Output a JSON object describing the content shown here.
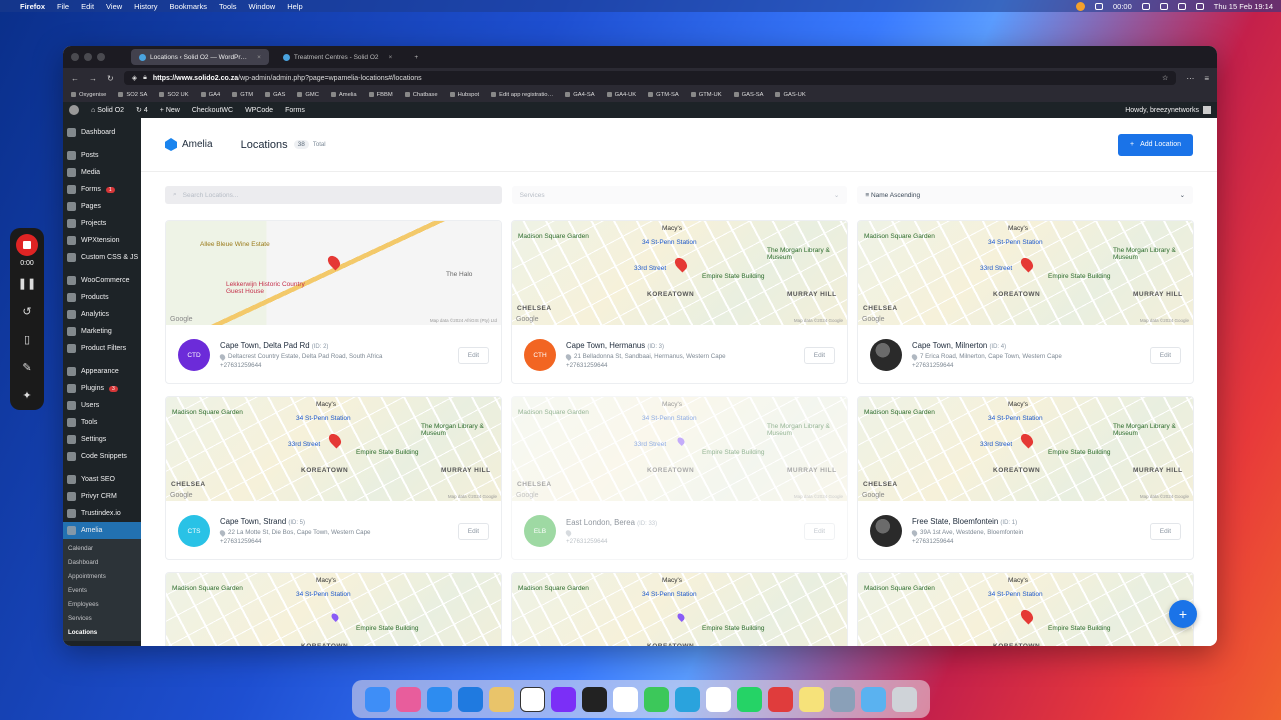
{
  "menubar": {
    "apple": "",
    "items": [
      "Firefox",
      "File",
      "Edit",
      "View",
      "History",
      "Bookmarks",
      "Tools",
      "Window",
      "Help"
    ],
    "clock": "00:00",
    "datetime": "Thu 15 Feb  19:14"
  },
  "recorder": {
    "time": "0:00"
  },
  "browser": {
    "tabs": [
      {
        "label": "Locations ‹ Solid O2 — WordPr…"
      },
      {
        "label": "Treatment Centres - Solid O2"
      }
    ],
    "url_host": "https://www.solido2.co.za",
    "url_path": "/wp-admin/admin.php?page=wpamelia-locations#/locations",
    "bookmarks": [
      "Oxygenise",
      "SO2 SA",
      "SO2 UK",
      "GA4",
      "GTM",
      "GAS",
      "GMC",
      "Amelia",
      "FBBM",
      "Chatbase",
      "Hubspot",
      "Edit app registratio…",
      "GA4-SA",
      "GA4-UK",
      "GTM-SA",
      "GTM-UK",
      "GAS-SA",
      "GAS-UK"
    ]
  },
  "adminbar": {
    "site": "Solid O2",
    "updates": "4",
    "new": "New",
    "checkout": "CheckoutWC",
    "wpcode": "WPCode",
    "forms": "Forms",
    "howdy": "Howdy, breezynetworks"
  },
  "sidebar": {
    "items": [
      {
        "label": "Dashboard"
      },
      {
        "label": "Posts"
      },
      {
        "label": "Media"
      },
      {
        "label": "Forms",
        "badge": "1"
      },
      {
        "label": "Pages"
      },
      {
        "label": "Projects"
      },
      {
        "label": "WPXtension"
      },
      {
        "label": "Custom CSS & JS"
      },
      {
        "label": "WooCommerce"
      },
      {
        "label": "Products"
      },
      {
        "label": "Analytics"
      },
      {
        "label": "Marketing"
      },
      {
        "label": "Product Filters"
      },
      {
        "label": "Appearance"
      },
      {
        "label": "Plugins",
        "badge": "3"
      },
      {
        "label": "Users"
      },
      {
        "label": "Tools"
      },
      {
        "label": "Settings"
      },
      {
        "label": "Code Snippets"
      },
      {
        "label": "Yoast SEO"
      },
      {
        "label": "Privyr CRM"
      },
      {
        "label": "Trustindex.io"
      },
      {
        "label": "Amelia"
      }
    ],
    "sub": [
      "Calendar",
      "Dashboard",
      "Appointments",
      "Events",
      "Employees",
      "Services",
      "Locations"
    ]
  },
  "amelia": {
    "brand": "Amelia",
    "title": "Locations",
    "count": "38",
    "total_label": "Total",
    "add_label": "Add Location",
    "search_placeholder": "Search Locations...",
    "services_placeholder": "Services",
    "sort_label": "Name Ascending",
    "edit_label": "Edit"
  },
  "locations": [
    {
      "initials": "CTD",
      "color": "#6c2bd9",
      "name": "Cape Town, Delta Pad Rd",
      "id": "(ID: 2)",
      "address": "Deltacrest Country Estate, Delta Pad Road, South Africa",
      "phone": "+27631259644",
      "map": "cape"
    },
    {
      "initials": "CTH",
      "color": "#f26522",
      "name": "Cape Town, Hermanus",
      "id": "(ID: 3)",
      "address": "21 Belladonna St, Sandbaai, Hermanus, Western Cape",
      "phone": "+27631259644",
      "map": "nyc"
    },
    {
      "initials": "",
      "color": "",
      "name": "Cape Town, Milnerton",
      "id": "(ID: 4)",
      "address": "7 Erica Road, Milnerton, Cape Town, Western Cape",
      "phone": "+27631259644",
      "map": "nyc"
    },
    {
      "initials": "CTS",
      "color": "#29c2e6",
      "name": "Cape Town, Strand",
      "id": "(ID: 5)",
      "address": "22 La Motte St, Die Bos, Cape Town, Western Cape",
      "phone": "+27631259644",
      "map": "nyc"
    },
    {
      "initials": "ELB",
      "color": "#3fb549",
      "name": "East London, Berea",
      "id": "(ID: 33)",
      "address": "",
      "phone": "+27631259644",
      "map": "nyc"
    },
    {
      "initials": "",
      "color": "",
      "name": "Free State, Bloemfontein",
      "id": "(ID: 1)",
      "address": "39A 1st Ave, Westdene, Bloemfontein",
      "phone": "+27631259644",
      "map": "nyc"
    }
  ],
  "map_labels": {
    "msg": "Madison Square Garden",
    "macys": "Macy's",
    "penn": "34 St-Penn Station",
    "morgan": "The Morgan Library & Museum",
    "empire": "Empire State Building",
    "koreatown": "KOREATOWN",
    "murray": "MURRAY HILL",
    "chelsea": "CHELSEA",
    "st33": "33rd Street",
    "st28": "28 St",
    "google": "Google",
    "mapdata_nyc": "Map data ©2024 Google",
    "allee": "Allee Bleue Wine Estate",
    "lekkerwijn": "Lekkerwijn Historic Country Guest House",
    "halo": "The Halo",
    "mapdata_cape": "Map data ©2024 AfriGIS (Pty) Ltd"
  }
}
